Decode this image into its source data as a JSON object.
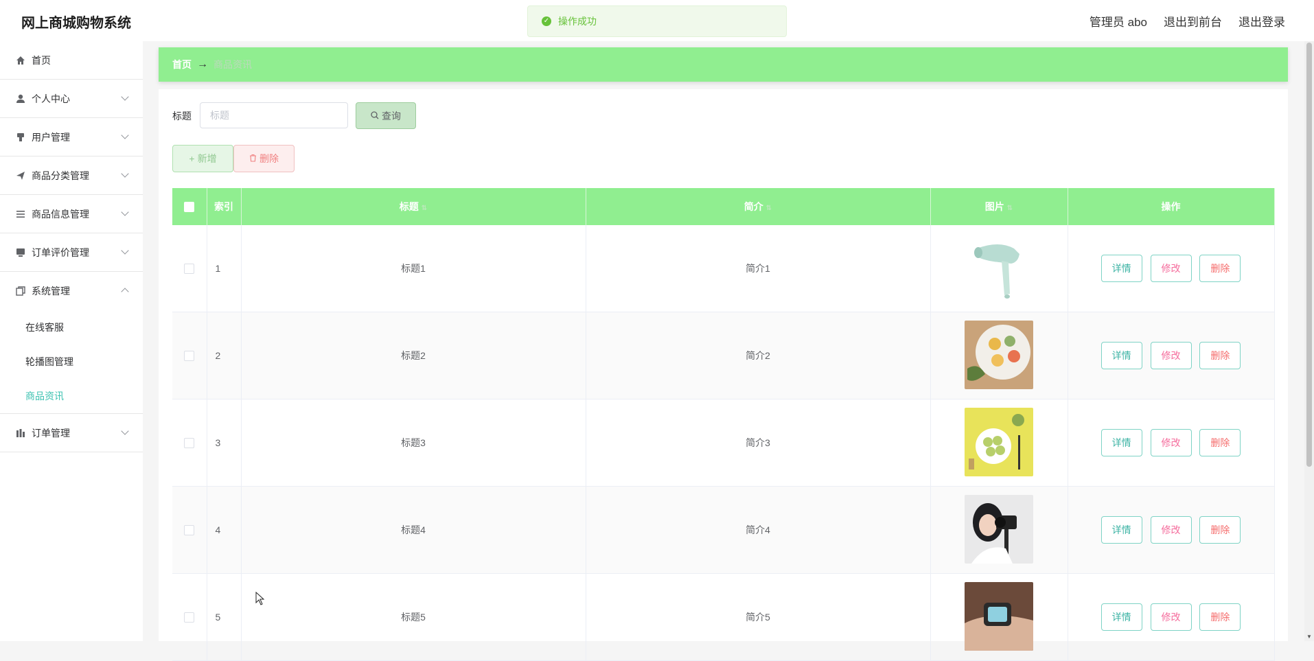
{
  "header": {
    "app_title": "网上商城购物系统",
    "admin_label": "管理员 abo",
    "to_frontend": "退出到前台",
    "logout": "退出登录"
  },
  "toast": {
    "message": "操作成功",
    "icon": "check-circle-icon"
  },
  "sidebar": {
    "items": [
      {
        "label": "首页",
        "icon": "home-icon"
      },
      {
        "label": "个人中心",
        "icon": "user-icon"
      },
      {
        "label": "用户管理",
        "icon": "user-manage-icon"
      },
      {
        "label": "商品分类管理",
        "icon": "send-icon"
      },
      {
        "label": "商品信息管理",
        "icon": "list-icon"
      },
      {
        "label": "订单评价管理",
        "icon": "monitor-icon"
      },
      {
        "label": "系统管理",
        "icon": "copy-icon"
      },
      {
        "label": "订单管理",
        "icon": "chart-icon"
      }
    ],
    "sub_items": [
      {
        "label": "在线客服"
      },
      {
        "label": "轮播图管理"
      },
      {
        "label": "商品资讯"
      }
    ]
  },
  "breadcrumb": {
    "home": "首页",
    "current": "商品资讯"
  },
  "search": {
    "label": "标题",
    "placeholder": "标题",
    "query_button": "查询"
  },
  "actions": {
    "add_button": "新增",
    "delete_button": "删除"
  },
  "table": {
    "columns": [
      "索引",
      "标题",
      "简介",
      "图片",
      "操作"
    ],
    "rows": [
      {
        "index": "1",
        "title": "标题1",
        "intro": "简介1",
        "image": "hair-dryer"
      },
      {
        "index": "2",
        "title": "标题2",
        "intro": "简介2",
        "image": "mooncakes-plate"
      },
      {
        "index": "3",
        "title": "标题3",
        "intro": "简介3",
        "image": "matcha-cookies"
      },
      {
        "index": "4",
        "title": "标题4",
        "intro": "简介4",
        "image": "girl-with-camera"
      },
      {
        "index": "5",
        "title": "标题5",
        "intro": "简介5",
        "image": "wrist-watch"
      }
    ],
    "row_actions": {
      "detail": "详情",
      "edit": "修改",
      "delete": "删除"
    }
  },
  "colors": {
    "accent": "#90ee90",
    "active_menu": "#3cc2b1",
    "danger": "#f56c6c"
  }
}
